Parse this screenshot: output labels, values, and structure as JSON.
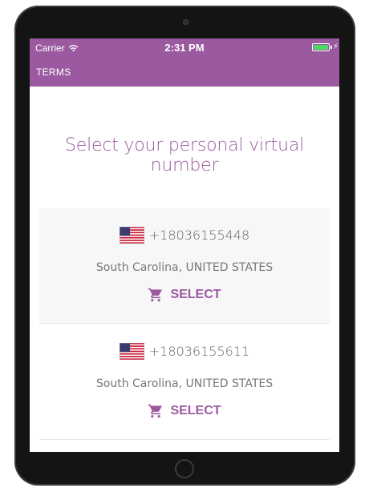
{
  "status_bar": {
    "carrier": "Carrier",
    "time": "2:31 PM",
    "battery_level": 1.0,
    "charging": true
  },
  "header": {
    "terms_label": "TERMS",
    "background_color": "#9b5aa0"
  },
  "page": {
    "title": "Select your personal virtual number"
  },
  "numbers": [
    {
      "flag": "us-flag-icon",
      "number": "+18036155448",
      "location": "South Carolina, UNITED STATES",
      "select_label": "SELECT"
    },
    {
      "flag": "us-flag-icon",
      "number": "+18036155611",
      "location": "South Carolina, UNITED STATES",
      "select_label": "SELECT"
    }
  ],
  "colors": {
    "accent": "#9b5aa0",
    "battery": "#4cd964"
  }
}
